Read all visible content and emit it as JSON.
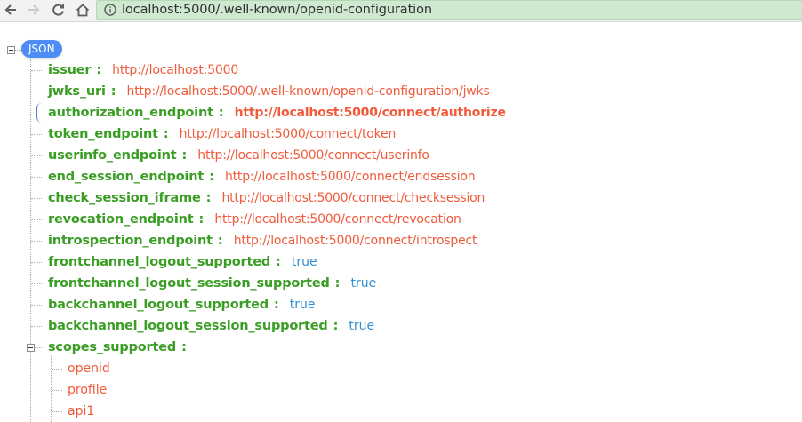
{
  "browser": {
    "back_icon": "arrow-left-icon",
    "forward_icon": "arrow-right-icon",
    "reload_icon": "reload-icon",
    "home_icon": "home-icon",
    "info_icon": "info-icon",
    "url": "localhost:5000/.well-known/openid-configuration"
  },
  "json_view": {
    "root_label": "JSON",
    "entries": [
      {
        "key": "issuer",
        "value": "http://localhost:5000",
        "type": "string"
      },
      {
        "key": "jwks_uri",
        "value": "http://localhost:5000/.well-known/openid-configuration/jwks",
        "type": "string"
      },
      {
        "key": "authorization_endpoint",
        "value": "http://localhost:5000/connect/authorize",
        "type": "string"
      },
      {
        "key": "token_endpoint",
        "value": "http://localhost:5000/connect/token",
        "type": "string"
      },
      {
        "key": "userinfo_endpoint",
        "value": "http://localhost:5000/connect/userinfo",
        "type": "string"
      },
      {
        "key": "end_session_endpoint",
        "value": "http://localhost:5000/connect/endsession",
        "type": "string"
      },
      {
        "key": "check_session_iframe",
        "value": "http://localhost:5000/connect/checksession",
        "type": "string"
      },
      {
        "key": "revocation_endpoint",
        "value": "http://localhost:5000/connect/revocation",
        "type": "string"
      },
      {
        "key": "introspection_endpoint",
        "value": "http://localhost:5000/connect/introspect",
        "type": "string"
      },
      {
        "key": "frontchannel_logout_supported",
        "value": "true",
        "type": "bool"
      },
      {
        "key": "frontchannel_logout_session_supported",
        "value": "true",
        "type": "bool"
      },
      {
        "key": "backchannel_logout_supported",
        "value": "true",
        "type": "bool"
      },
      {
        "key": "backchannel_logout_session_supported",
        "value": "true",
        "type": "bool"
      },
      {
        "key": "scopes_supported",
        "value": "",
        "type": "array"
      }
    ],
    "colon": ":",
    "scopes_supported_items": [
      "openid",
      "profile",
      "api1"
    ]
  },
  "colors": {
    "key": "#3a9e24",
    "string_value": "#ef5b3c",
    "bool_value": "#2f8fd1",
    "root_badge": "#4e8cf5",
    "url_bar": "#cfe8d0"
  }
}
